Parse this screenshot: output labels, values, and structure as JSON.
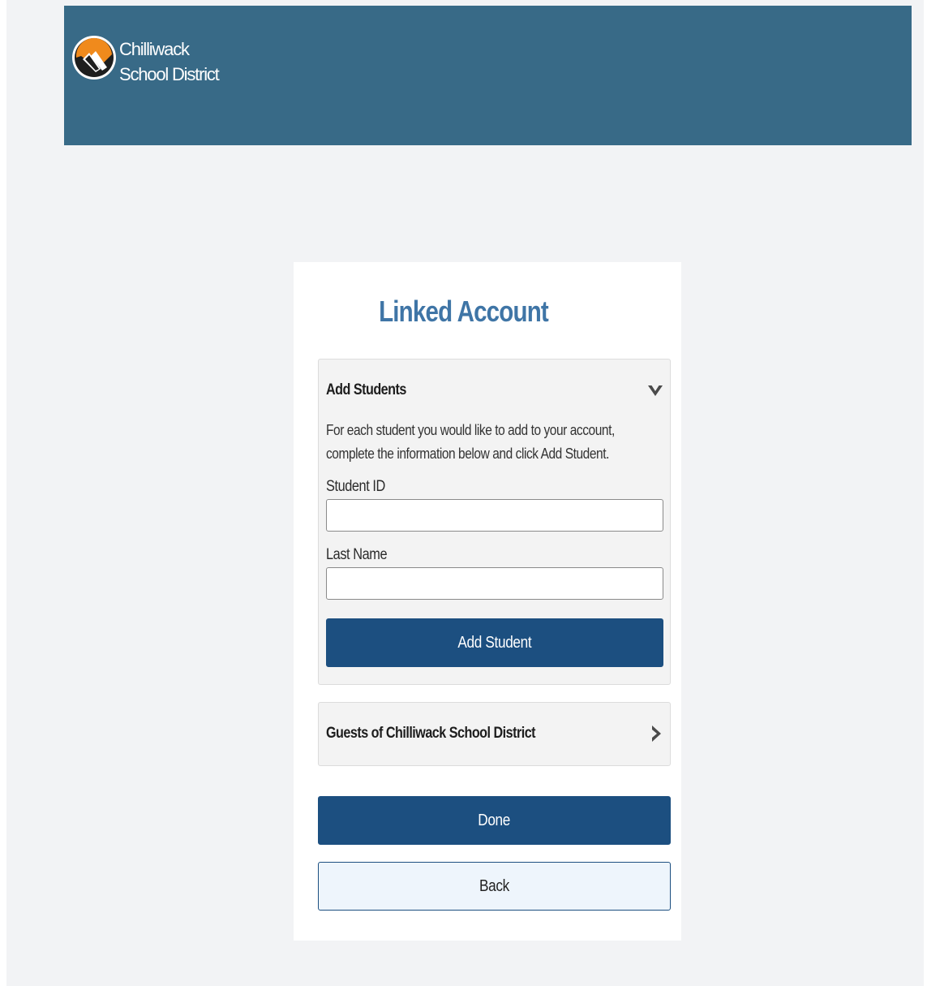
{
  "header": {
    "logo_line1": "Chilliwack",
    "logo_line2": "School District"
  },
  "card": {
    "title": "Linked Account",
    "add_students": {
      "heading": "Add Students",
      "expand_icon": "chevron-down-icon",
      "description": "For each student you would like to add to your account, complete the information below and click Add Student.",
      "student_id_label": "Student ID",
      "student_id_value": "",
      "last_name_label": "Last Name",
      "last_name_value": "",
      "add_button_label": "Add Student"
    },
    "guests": {
      "heading": "Guests of Chilliwack School District",
      "expand_icon": "chevron-right-icon"
    },
    "done_label": "Done",
    "back_label": "Back"
  },
  "colors": {
    "header_bg": "#386a87",
    "title": "#3f75a6",
    "primary_button": "#1c4f80",
    "page_bg": "#f2f3f5",
    "logo_orange": "#f08a1c"
  }
}
